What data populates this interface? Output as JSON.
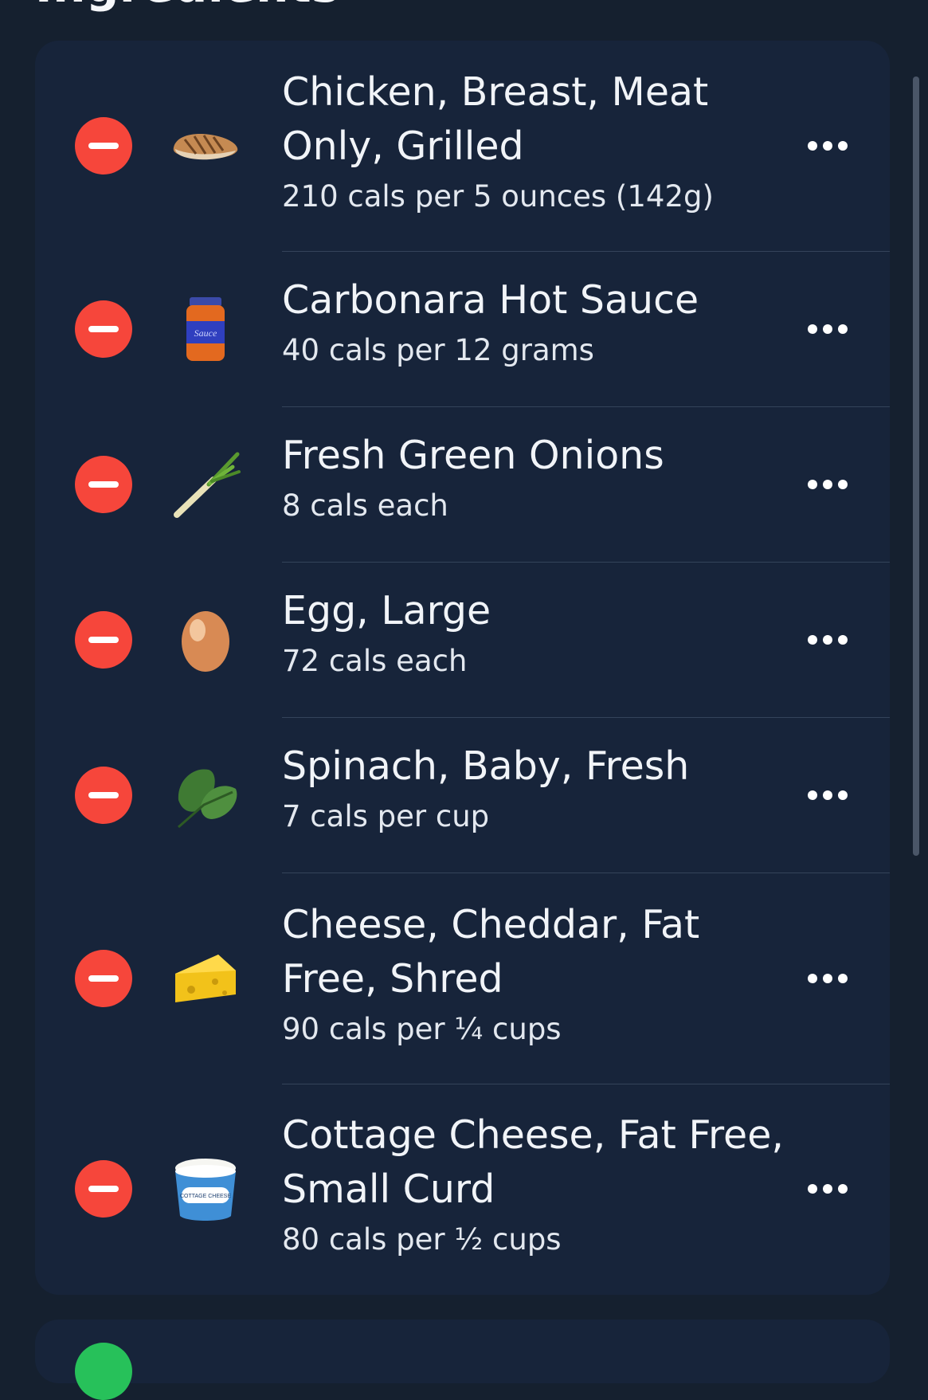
{
  "section": {
    "title": "Ingredients"
  },
  "ingredients": [
    {
      "name_lines": [
        "Chicken, Breast, Meat",
        "Only, Grilled"
      ],
      "calories": "210 cals per 5 ounces (142g)",
      "icon": "grilled-chicken-icon"
    },
    {
      "name_lines": [
        "Carbonara Hot Sauce"
      ],
      "calories": "40 cals per 12 grams",
      "icon": "sauce-jar-icon",
      "jar_label": "Sauce"
    },
    {
      "name_lines": [
        "Fresh Green Onions"
      ],
      "calories": "8 cals each",
      "icon": "green-onion-icon"
    },
    {
      "name_lines": [
        "Egg, Large"
      ],
      "calories": "72 cals each",
      "icon": "egg-icon"
    },
    {
      "name_lines": [
        "Spinach, Baby, Fresh"
      ],
      "calories": "7 cals per cup",
      "icon": "spinach-leaf-icon"
    },
    {
      "name_lines": [
        "Cheese, Cheddar, Fat",
        "Free, Shred"
      ],
      "calories": "90 cals per ¼ cups",
      "icon": "cheese-wedge-icon"
    },
    {
      "name_lines": [
        "Cottage Cheese, Fat Free,",
        "Small Curd"
      ],
      "calories": "80 cals per ½ cups",
      "icon": "cottage-cheese-tub-icon",
      "tub_label": "COTTAGE CHEESE"
    }
  ],
  "colors": {
    "background": "#15202f",
    "card": "#17243a",
    "remove": "#f6463b",
    "add": "#27c15a",
    "divider": "#34435a"
  }
}
